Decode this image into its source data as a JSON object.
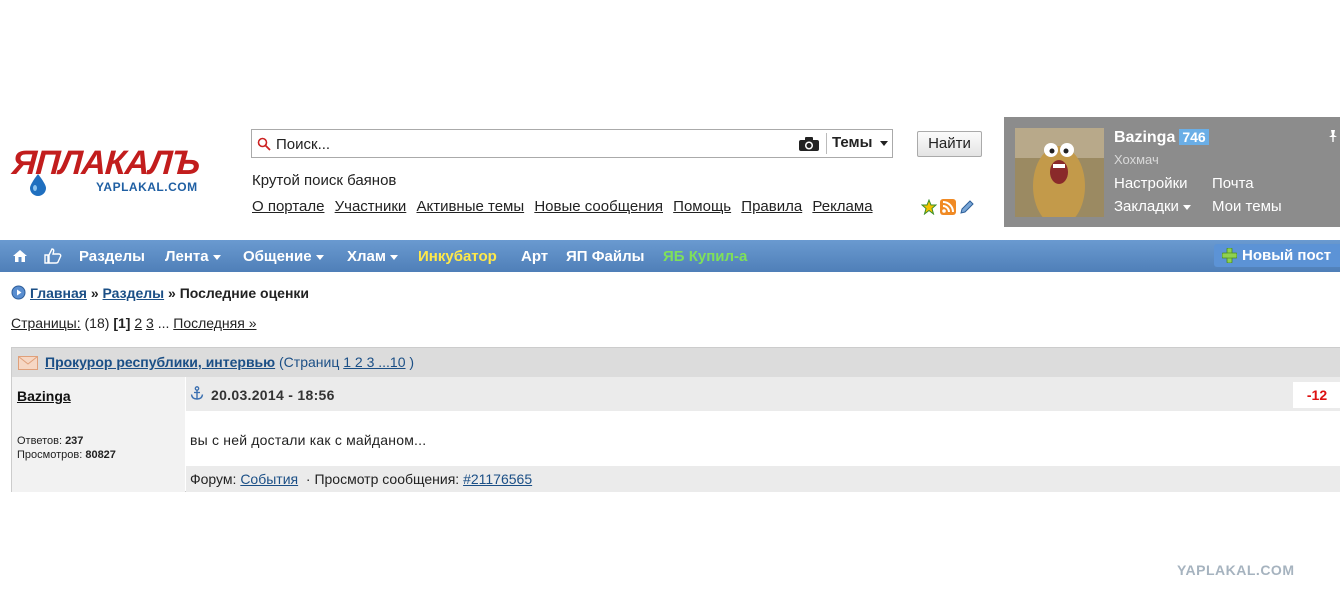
{
  "logo": {
    "main": "ЯПЛАКАЛЪ",
    "sub": "YAPLAKAL.COM"
  },
  "search": {
    "placeholder": "Поиск...",
    "scope": "Темы",
    "button": "Найти"
  },
  "slogan": "Крутой поиск баянов",
  "top_links": [
    "О портале",
    "Участники",
    "Активные темы",
    "Новые сообщения",
    "Помощь",
    "Правила",
    "Реклама"
  ],
  "user": {
    "name": "Bazinga",
    "karma": "746",
    "rank": "Хохмач",
    "settings": "Настройки",
    "mail": "Почта",
    "bookmarks": "Закладки",
    "my_topics": "Мои темы"
  },
  "nav": {
    "sections": "Разделы",
    "feed": "Лента",
    "talk": "Общение",
    "junk": "Хлам",
    "incubator": "Инкубатор",
    "art": "Арт",
    "files": "ЯП Файлы",
    "bought": "ЯБ Купил-а",
    "new_post": "Новый пост",
    "colors": {
      "incubator": "#ffe94a",
      "bought": "#7fe05a"
    }
  },
  "breadcrumb": {
    "home": "Главная",
    "sep": "»",
    "sections": "Разделы",
    "current": "Последние оценки"
  },
  "pages": {
    "label": "Страницы:",
    "count": "(18)",
    "current": "[1]",
    "p2": "2",
    "p3": "3",
    "dots": "...",
    "last": "Последняя »"
  },
  "topic": {
    "title": "Прокурор республики, интервью",
    "pages_open": "(Страниц",
    "pages_links": "1 2 3 ...10",
    "pages_close": ")",
    "author": "Bazinga",
    "replies_label": "Ответов:",
    "replies": "237",
    "views_label": "Просмотров:",
    "views": "80827",
    "date": "20.03.2014 - 18:56",
    "rating": "-12",
    "text": "вы с ней достали как с майданом...",
    "forum_label": "Форум:",
    "forum": "События",
    "view_label": "· Просмотр сообщения:",
    "post_id": "#21176565"
  },
  "watermark": "YAPLAKAL.COM"
}
